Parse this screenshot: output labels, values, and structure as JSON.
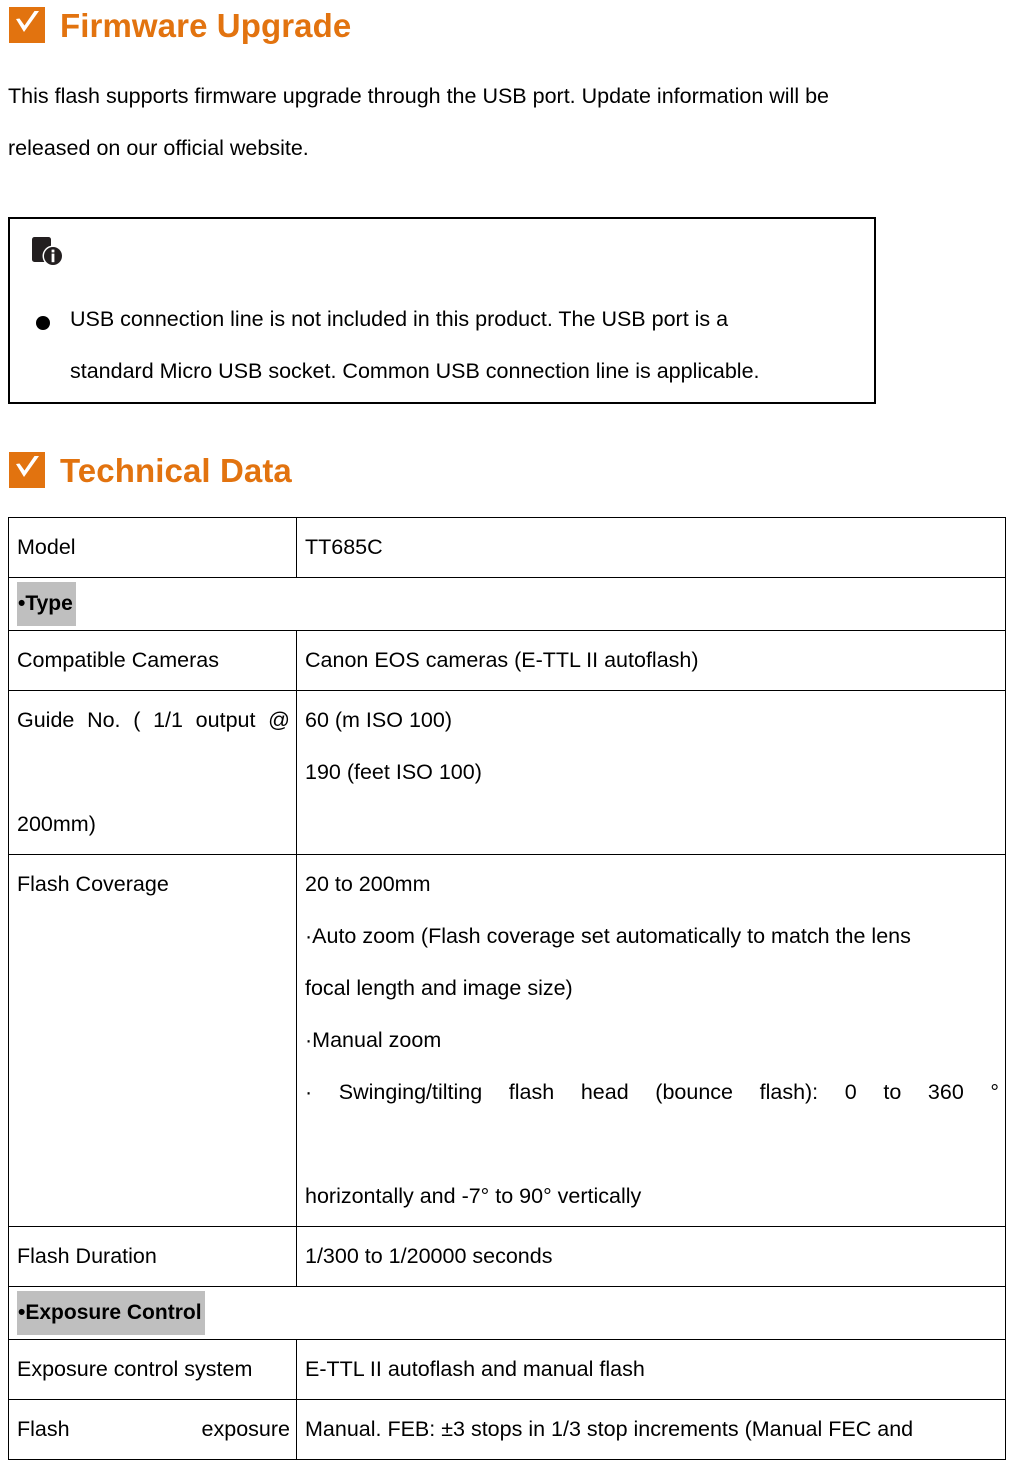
{
  "document": {
    "sections": [
      {
        "icon": "orange-check-badge-icon",
        "title": "Firmware Upgrade"
      },
      {
        "icon": "orange-check-badge-icon",
        "title": "Technical Data"
      }
    ],
    "accent_color": "#E2730F",
    "highlight_color": "#BFBFBF"
  },
  "intro": {
    "line1": "This flash supports firmware upgrade through the USB port. Update information will be",
    "line2": "released on our official website."
  },
  "note": {
    "icon": "device-info-icon",
    "bullet": "●",
    "line1": "USB connection line is not included in this product. The USB port is a",
    "line2": "standard Micro USB socket. Common USB connection line is applicable."
  },
  "technical_table": {
    "rows": [
      {
        "type": "pair-wide-label",
        "label": "Model",
        "value": "TT685C"
      },
      {
        "type": "section",
        "label": "•Type"
      },
      {
        "type": "pair",
        "label": "Compatible Cameras",
        "value_lines": [
          "Canon EOS cameras (E-TTL II autoflash)"
        ]
      },
      {
        "type": "pair",
        "label_lines": [
          "Guide No. ( 1/1 output @",
          "200mm)"
        ],
        "label_justified_first_line": true,
        "value_lines": [
          "60 (m ISO 100)",
          "190 (feet ISO 100)"
        ]
      },
      {
        "type": "pair",
        "label": "Flash Coverage",
        "value_lines": [
          "20 to 200mm",
          "·Auto zoom (Flash coverage set automatically to match the lens",
          "focal length and image size)",
          "·Manual zoom",
          "· Swinging/tilting flash head (bounce flash): 0 to 360 °",
          "horizontally and -7° to 90° vertically"
        ],
        "justified_lines": [
          4
        ]
      },
      {
        "type": "pair",
        "label": "Flash Duration",
        "value_lines": [
          "1/300 to 1/20000 seconds"
        ]
      },
      {
        "type": "section",
        "label": "•Exposure Control"
      },
      {
        "type": "pair",
        "label": "Exposure control system",
        "value_lines": [
          "E-TTL II autoflash and manual flash"
        ]
      },
      {
        "type": "pair",
        "label_left": "Flash",
        "label_right": "exposure",
        "label_spread": true,
        "value_lines": [
          "Manual. FEB:  ±3 stops in 1/3 stop increments (Manual FEC and"
        ]
      }
    ]
  }
}
